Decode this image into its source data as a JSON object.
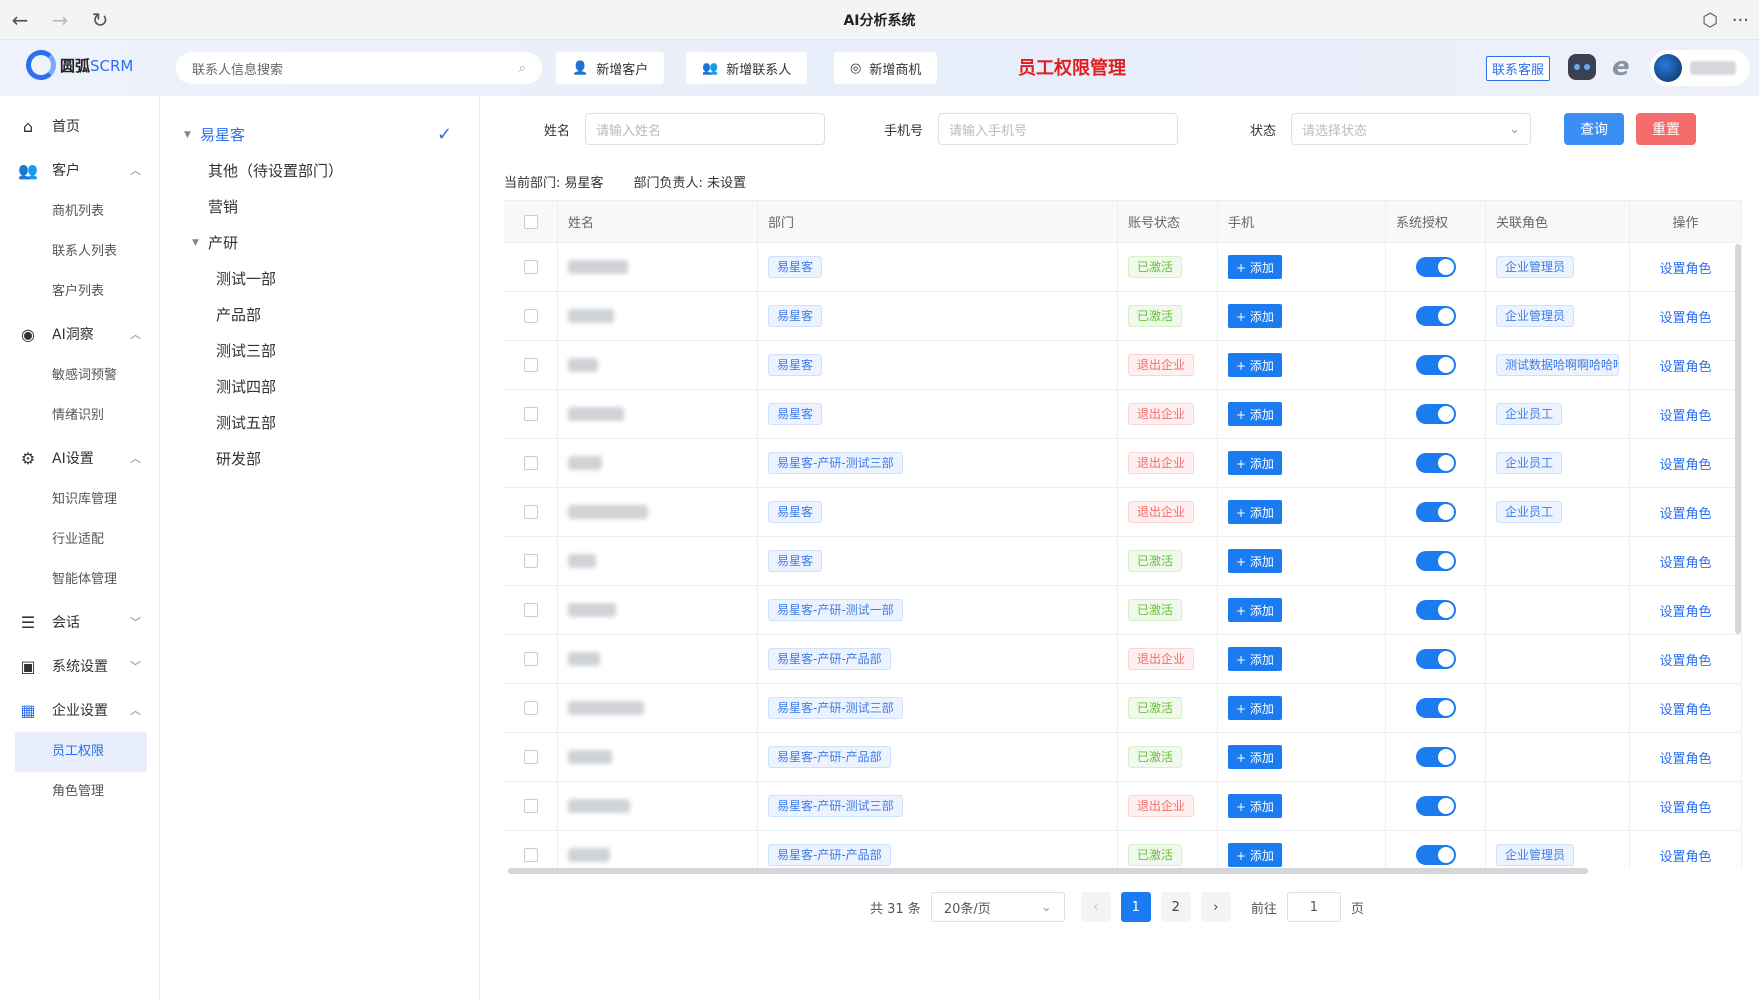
{
  "window": {
    "title": "AI分析系统"
  },
  "header": {
    "brand": "圆弧",
    "brand_suffix": "SCRM",
    "search_placeholder": "联系人信息搜索",
    "buttons": [
      "新增客户",
      "新增联系人",
      "新增商机"
    ],
    "page_title": "员工权限管理",
    "support_label": "联系客服"
  },
  "sidebar": {
    "items": [
      {
        "label": "首页",
        "icon": "home-icon"
      },
      {
        "label": "客户",
        "icon": "users-icon",
        "expanded": true,
        "children": [
          "商机列表",
          "联系人列表",
          "客户列表"
        ]
      },
      {
        "label": "AI洞察",
        "icon": "insight-icon",
        "expanded": true,
        "children": [
          "敏感词预警",
          "情绪识别"
        ]
      },
      {
        "label": "AI设置",
        "icon": "ai-settings-icon",
        "expanded": true,
        "children": [
          "知识库管理",
          "行业适配",
          "智能体管理"
        ]
      },
      {
        "label": "会话",
        "icon": "chat-icon",
        "expanded": false,
        "children": []
      },
      {
        "label": "系统设置",
        "icon": "monitor-icon",
        "expanded": false,
        "children": []
      },
      {
        "label": "企业设置",
        "icon": "building-icon",
        "expanded": true,
        "children": [
          "员工权限",
          "角色管理"
        ]
      }
    ],
    "active": "员工权限"
  },
  "tree": {
    "root": "易星客",
    "children": [
      "其他（待设置部门）",
      "营销",
      "产研"
    ],
    "sub_children": [
      "测试一部",
      "产品部",
      "测试三部",
      "测试四部",
      "测试五部",
      "研发部"
    ]
  },
  "filters": {
    "name_label": "姓名",
    "name_placeholder": "请输入姓名",
    "phone_label": "手机号",
    "phone_placeholder": "请输入手机号",
    "status_label": "状态",
    "status_placeholder": "请选择状态",
    "query_label": "查询",
    "reset_label": "重置"
  },
  "dept_info": {
    "current_label": "当前部门:",
    "current_value": "易星客",
    "owner_label": "部门负责人:",
    "owner_value": "未设置"
  },
  "table": {
    "columns": [
      "姓名",
      "部门",
      "账号状态",
      "手机",
      "系统授权",
      "关联角色",
      "操作"
    ],
    "add_label": "+ 添加",
    "op_label": "设置角色",
    "rows": [
      {
        "dept": "易星客",
        "status": "已激活",
        "role": "企业管理员",
        "auth": true
      },
      {
        "dept": "易星客",
        "status": "已激活",
        "role": "企业管理员",
        "auth": true
      },
      {
        "dept": "易星客",
        "status": "退出企业",
        "role": "测试数据哈啊啊哈哈哈",
        "auth": true
      },
      {
        "dept": "易星客",
        "status": "退出企业",
        "role": "企业员工",
        "auth": true
      },
      {
        "dept": "易星客-产研-测试三部",
        "status": "退出企业",
        "role": "企业员工",
        "auth": true
      },
      {
        "dept": "易星客",
        "status": "退出企业",
        "role": "企业员工",
        "auth": true
      },
      {
        "dept": "易星客",
        "status": "已激活",
        "role": "",
        "auth": true
      },
      {
        "dept": "易星客-产研-测试一部",
        "status": "已激活",
        "role": "",
        "auth": true
      },
      {
        "dept": "易星客-产研-产品部",
        "status": "退出企业",
        "role": "",
        "auth": true
      },
      {
        "dept": "易星客-产研-测试三部",
        "status": "已激活",
        "role": "",
        "auth": true
      },
      {
        "dept": "易星客-产研-产品部",
        "status": "已激活",
        "role": "",
        "auth": true
      },
      {
        "dept": "易星客-产研-测试三部",
        "status": "退出企业",
        "role": "",
        "auth": true
      },
      {
        "dept": "易星客-产研-产品部",
        "status": "已激活",
        "role": "企业管理员",
        "auth": true
      }
    ]
  },
  "pagination": {
    "total_text": "共 31 条",
    "page_size": "20条/页",
    "pages": [
      "1",
      "2"
    ],
    "current": "1",
    "goto_label": "前往",
    "goto_value": "1",
    "page_suffix": "页"
  },
  "colors": {
    "primary": "#1b7cf2",
    "danger": "#f56c6c",
    "title_red": "#e01f1f"
  }
}
